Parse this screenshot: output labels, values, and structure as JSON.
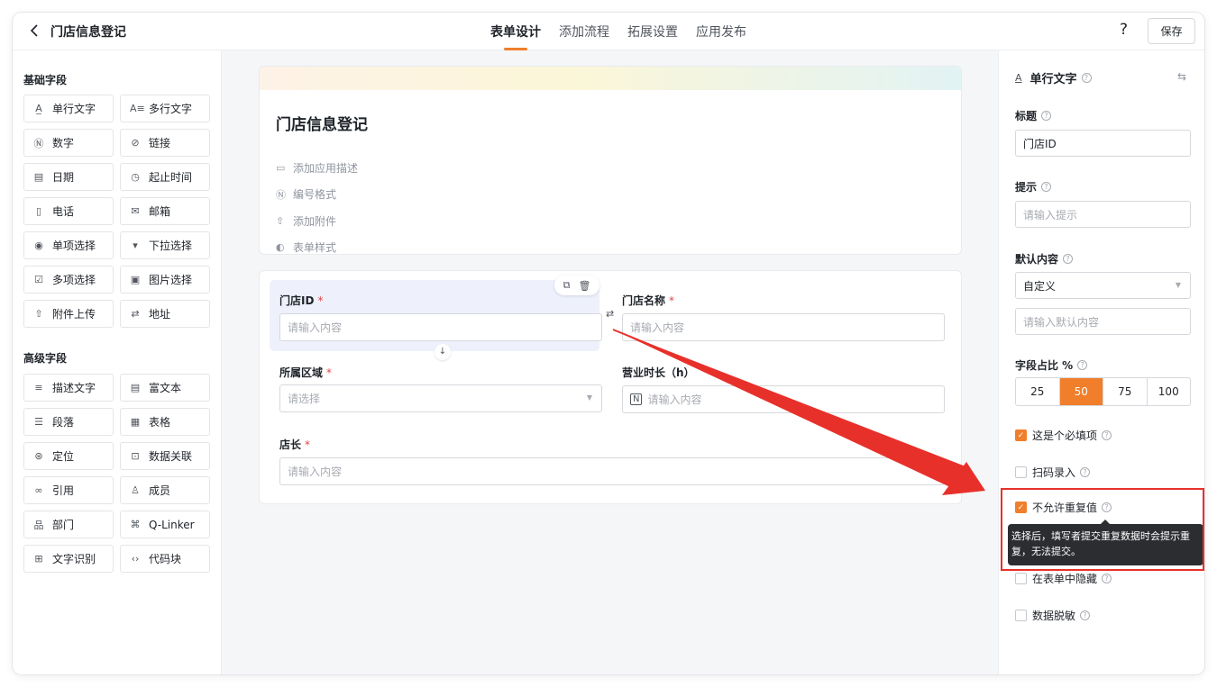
{
  "header": {
    "app_title": "门店信息登记",
    "tabs": [
      {
        "label": "表单设计",
        "active": true
      },
      {
        "label": "添加流程"
      },
      {
        "label": "拓展设置"
      },
      {
        "label": "应用发布"
      }
    ],
    "help": "?",
    "save_label": "保存"
  },
  "sidebar": {
    "basic_title": "基础字段",
    "basic_fields": [
      {
        "icon": "A̲",
        "icon_name": "single-line-text-icon",
        "label": "单行文字"
      },
      {
        "icon": "A≡",
        "icon_name": "multi-line-text-icon",
        "label": "多行文字"
      },
      {
        "icon": "Ⓝ",
        "icon_name": "number-icon",
        "label": "数字"
      },
      {
        "icon": "⊘",
        "icon_name": "link-icon",
        "label": "链接"
      },
      {
        "icon": "▤",
        "icon_name": "calendar-icon",
        "label": "日期"
      },
      {
        "icon": "◷",
        "icon_name": "time-range-icon",
        "label": "起止时间"
      },
      {
        "icon": "▯",
        "icon_name": "phone-icon",
        "label": "电话"
      },
      {
        "icon": "✉",
        "icon_name": "mail-icon",
        "label": "邮箱"
      },
      {
        "icon": "◉",
        "icon_name": "radio-icon",
        "label": "单项选择"
      },
      {
        "icon": "▾",
        "icon_name": "dropdown-icon",
        "label": "下拉选择"
      },
      {
        "icon": "☑",
        "icon_name": "checkbox-icon",
        "label": "多项选择"
      },
      {
        "icon": "▣",
        "icon_name": "image-select-icon",
        "label": "图片选择"
      },
      {
        "icon": "⇧",
        "icon_name": "upload-icon",
        "label": "附件上传"
      },
      {
        "icon": "⇄",
        "icon_name": "address-icon",
        "label": "地址"
      }
    ],
    "advanced_title": "高级字段",
    "advanced_fields": [
      {
        "icon": "≡",
        "icon_name": "description-icon",
        "label": "描述文字"
      },
      {
        "icon": "▤",
        "icon_name": "rich-text-icon",
        "label": "富文本"
      },
      {
        "icon": "☰",
        "icon_name": "paragraph-icon",
        "label": "段落"
      },
      {
        "icon": "▦",
        "icon_name": "table-icon",
        "label": "表格"
      },
      {
        "icon": "⊛",
        "icon_name": "location-icon",
        "label": "定位"
      },
      {
        "icon": "⊡",
        "icon_name": "data-link-icon",
        "label": "数据关联"
      },
      {
        "icon": "∞",
        "icon_name": "reference-icon",
        "label": "引用"
      },
      {
        "icon": "♙",
        "icon_name": "member-icon",
        "label": "成员"
      },
      {
        "icon": "品",
        "icon_name": "department-icon",
        "label": "部门"
      },
      {
        "icon": "⌘",
        "icon_name": "q-linker-icon",
        "label": "Q-Linker"
      },
      {
        "icon": "⊞",
        "icon_name": "ocr-icon",
        "label": "文字识别"
      },
      {
        "icon": "‹›",
        "icon_name": "code-block-icon",
        "label": "代码块"
      }
    ]
  },
  "form": {
    "title": "门店信息登记",
    "options": [
      {
        "icon": "▭",
        "icon_name": "description-icon",
        "label": "添加应用描述"
      },
      {
        "icon": "Ⓝ",
        "icon_name": "number-format-icon",
        "label": "编号格式"
      },
      {
        "icon": "⇧",
        "icon_name": "attachment-icon",
        "label": "添加附件"
      },
      {
        "icon": "◐",
        "icon_name": "palette-icon",
        "label": "表单样式"
      }
    ],
    "fields": {
      "store_id": {
        "label": "门店ID",
        "required": "*",
        "placeholder": "请输入内容"
      },
      "store_name": {
        "label": "门店名称",
        "required": "*",
        "placeholder": "请输入内容"
      },
      "region": {
        "label": "所属区域",
        "required": "*",
        "placeholder": "请选择"
      },
      "hours": {
        "label": "营业时长（h）",
        "placeholder": "请输入内容"
      },
      "manager": {
        "label": "店长",
        "required": "*",
        "placeholder": "请输入内容"
      }
    }
  },
  "panel": {
    "title": "单行文字",
    "title_field": {
      "label": "标题",
      "value": "门店ID"
    },
    "hint_field": {
      "label": "提示",
      "placeholder": "请输入提示"
    },
    "default_field": {
      "label": "默认内容",
      "select_value": "自定义",
      "placeholder": "请输入默认内容"
    },
    "ratio": {
      "label": "字段占比 %",
      "options": [
        "25",
        "50",
        "75",
        "100"
      ],
      "selected": "50"
    },
    "checks": [
      {
        "label": "这是个必填项",
        "checked": true
      },
      {
        "label": "扫码录入",
        "checked": false
      },
      {
        "label": "不允许重复值",
        "checked": true
      },
      {
        "label": "在表单中隐藏",
        "checked": false
      },
      {
        "label": "数据脱敏",
        "checked": false
      }
    ],
    "tooltip": "选择后，填写者提交重复数据时会提示重复，无法提交。"
  },
  "colors": {
    "accent": "#f07e2b",
    "annotation": "#e8302a",
    "required": "#e54545"
  }
}
